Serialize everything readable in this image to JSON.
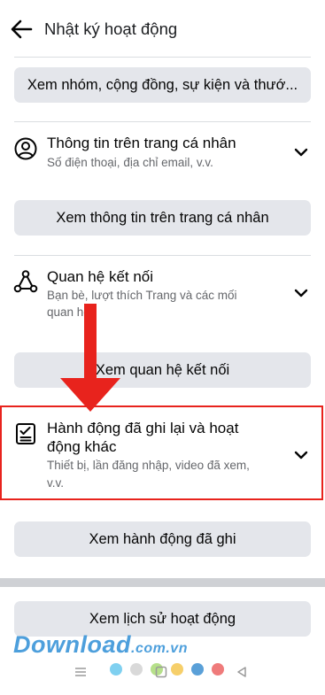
{
  "header": {
    "title": "Nhật ký hoạt động"
  },
  "buttons": {
    "groups": "Xem nhóm, cộng đồng, sự kiện và thướ...",
    "profile": "Xem thông tin trên trang cá nhân",
    "connections": "Xem quan hệ kết nối",
    "logged": "Xem hành động đã ghi",
    "history": "Xem lịch sử hoạt động"
  },
  "sections": {
    "profile": {
      "title": "Thông tin trên trang cá nhân",
      "subtitle": "Số điện thoại, địa chỉ email, v.v."
    },
    "connections": {
      "title": "Quan hệ kết nối",
      "subtitle_line1": "Bạn bè, lượt thích Trang và các mối",
      "subtitle_line2": "quan hệ"
    },
    "logged": {
      "title_line1": "Hành động đã ghi lại và hoạt",
      "title_line2": "động khác",
      "subtitle_line1": "Thiết bị, lần đăng nhập, video đã xem,",
      "subtitle_line2": "v.v."
    }
  },
  "watermark": {
    "brand": "Download",
    "domain": ".com.vn"
  },
  "colors": {
    "button_bg": "#e4e6eb",
    "highlight": "#e8231d",
    "arrow": "#e8231d",
    "watermark": "#2f8fd6",
    "dots": [
      "#7fd0f0",
      "#d9d9d9",
      "#b6e08a",
      "#f6cf6a",
      "#5aa0d8",
      "#ef7b7b"
    ]
  },
  "icons": [
    "back-arrow-icon",
    "person-icon",
    "connections-icon",
    "checklist-icon",
    "chevron-down-icon"
  ]
}
